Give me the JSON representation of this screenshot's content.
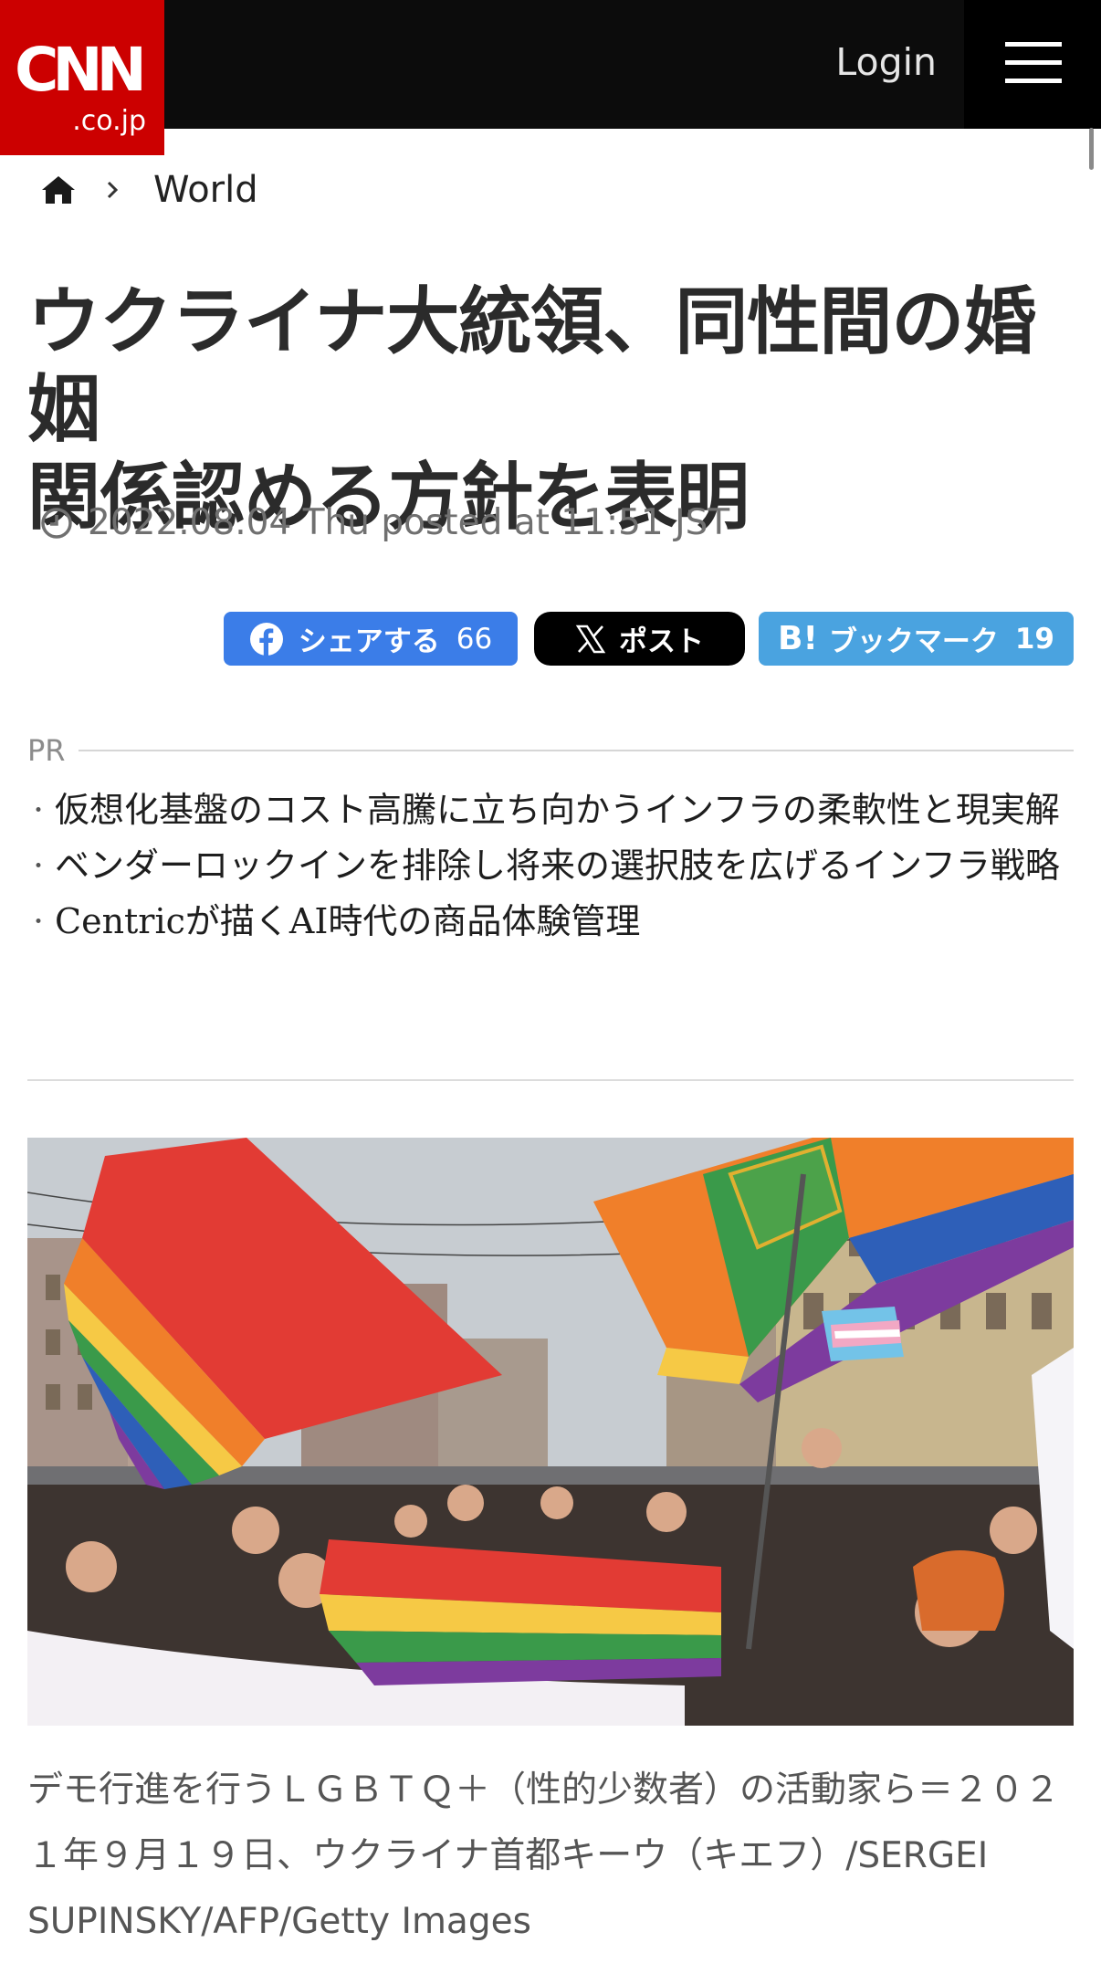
{
  "header": {
    "logo_text": "CNN",
    "logo_sub": ".co.jp",
    "login_label": "Login",
    "menu_icon": "hamburger-icon",
    "logo_color": "#cc0000",
    "bar_color": "#0c0c0c"
  },
  "breadcrumb": {
    "home_icon": "home-icon",
    "separator_icon": "chevron-right-icon",
    "section": "World"
  },
  "article": {
    "title_line1": "ウクライナ大統領、同性間の婚姻",
    "title_line2": "関係認める方針を表明",
    "date": "2022.08.04 Thu posted at 11:51 JST"
  },
  "share": {
    "facebook_label": "シェアする",
    "facebook_count": "66",
    "x_label": "ポスト",
    "hatena_label": "ブックマーク",
    "hatena_count": "19",
    "facebook_color": "#3b7de8",
    "x_color": "#000000",
    "hatena_color": "#4aa3e0"
  },
  "pr": {
    "label": "PR",
    "items": [
      "仮想化基盤のコスト高騰に立ち向かうインフラの柔軟性と現実解",
      "ベンダーロックインを排除し将来の選択肢を広げるインフラ戦略",
      "Centricが描くAI時代の商品体験管理"
    ]
  },
  "photo": {
    "caption": "デモ行進を行うＬＧＢＴＱ＋（性的少数者）の活動家ら＝２０２１年９月１９日、ウクライナ首都キーウ（キエフ）/SERGEI SUPINSKY/AFP/Getty Images"
  }
}
